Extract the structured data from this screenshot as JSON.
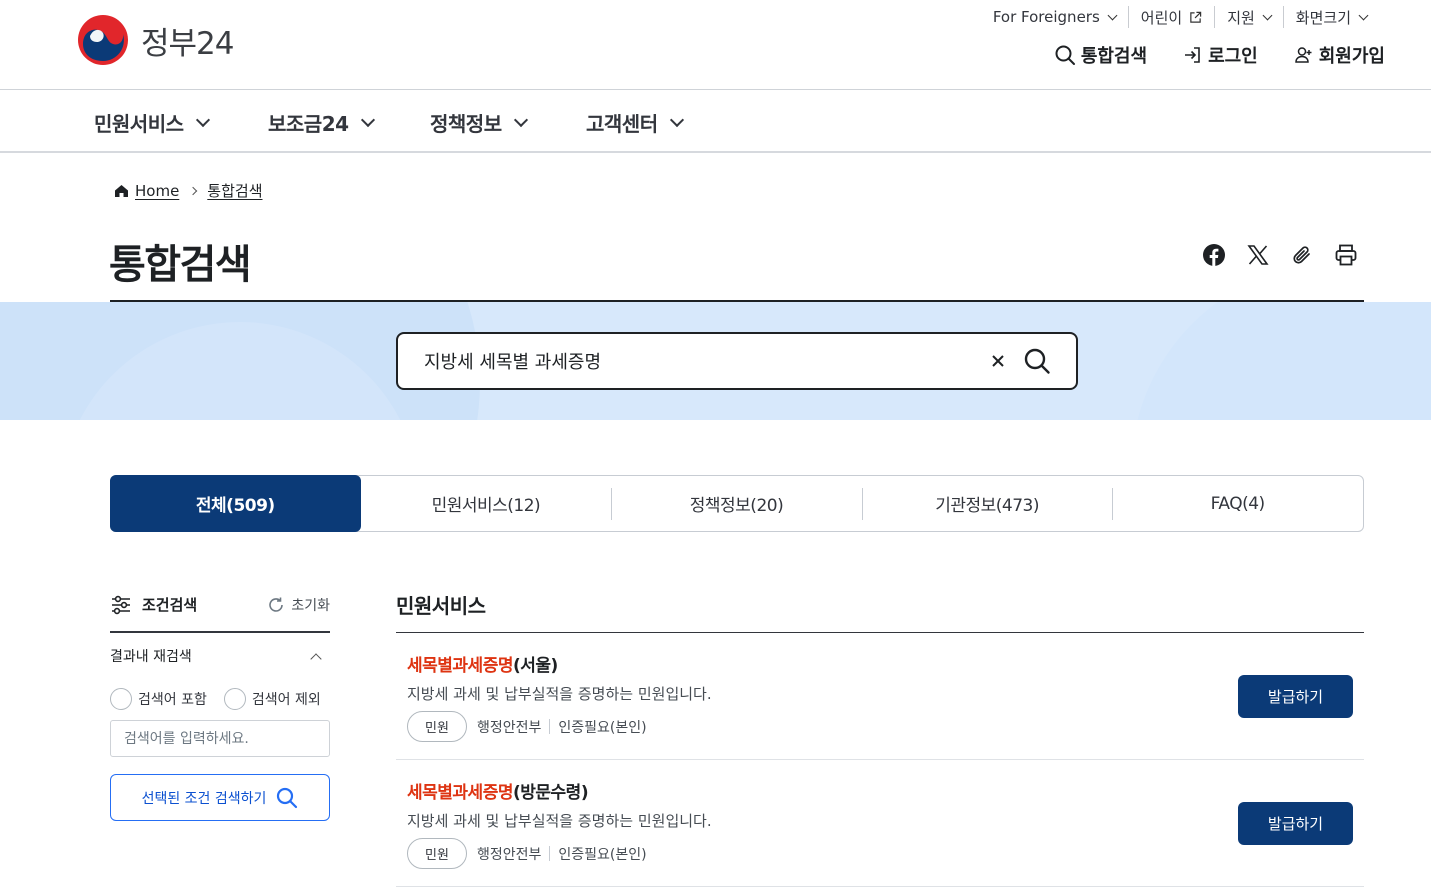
{
  "brand": {
    "logo_text": "정부24"
  },
  "utility_nav": {
    "foreigners": "For Foreigners",
    "kids": "어린이",
    "support": "지원",
    "screen_size": "화면크기"
  },
  "account_nav": {
    "search": "통합검색",
    "login": "로그인",
    "signup": "회원가입"
  },
  "gnb": [
    {
      "label": "민원서비스"
    },
    {
      "label": "보조금24"
    },
    {
      "label": "정책정보"
    },
    {
      "label": "고객센터"
    }
  ],
  "breadcrumb": {
    "home": "Home",
    "current": "통합검색"
  },
  "page_title": "통합검색",
  "search": {
    "value": "지방세 세목별 과세증명"
  },
  "tabs": [
    {
      "label": "전체(509)",
      "active": true
    },
    {
      "label": "민원서비스(12)",
      "active": false
    },
    {
      "label": "정책정보(20)",
      "active": false
    },
    {
      "label": "기관정보(473)",
      "active": false
    },
    {
      "label": "FAQ(4)",
      "active": false
    }
  ],
  "filter": {
    "title": "조건검색",
    "reset": "초기화",
    "refine_label": "결과내 재검색",
    "include": "검색어 포함",
    "exclude": "검색어 제외",
    "placeholder": "검색어를 입력하세요.",
    "submit": "선택된 조건 검색하기"
  },
  "results": {
    "section_title": "민원서비스",
    "items": [
      {
        "highlight": "세목별과세증명",
        "suffix": "(서울)",
        "description": "지방세 과세 및 납부실적을 증명하는 민원입니다.",
        "chip": "민원",
        "agency": "행정안전부",
        "auth": "인증필요(본인)",
        "button": "발급하기"
      },
      {
        "highlight": "세목별과세증명",
        "suffix": "(방문수령)",
        "description": "지방세 과세 및 납부실적을 증명하는 민원입니다.",
        "chip": "민원",
        "agency": "행정안전부",
        "auth": "인증필요(본인)",
        "button": "발급하기"
      }
    ]
  },
  "colors": {
    "primary": "#0b3a77",
    "highlight": "#de3412",
    "search_band": "#d7e8fb",
    "outline_blue": "#256ef4"
  }
}
